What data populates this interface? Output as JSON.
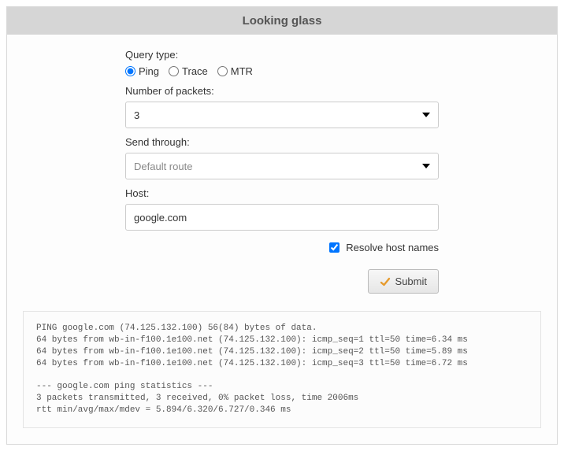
{
  "header": {
    "title": "Looking glass"
  },
  "form": {
    "query_type_label": "Query type:",
    "radios": {
      "ping": "Ping",
      "trace": "Trace",
      "mtr": "MTR",
      "selected": "ping"
    },
    "packets_label": "Number of packets:",
    "packets_value": "3",
    "send_through_label": "Send through:",
    "send_through_value": "Default route",
    "host_label": "Host:",
    "host_value": "google.com",
    "resolve_label": "Resolve host names",
    "resolve_checked": true,
    "submit_label": "Submit"
  },
  "output": "PING google.com (74.125.132.100) 56(84) bytes of data.\n64 bytes from wb-in-f100.1e100.net (74.125.132.100): icmp_seq=1 ttl=50 time=6.34 ms\n64 bytes from wb-in-f100.1e100.net (74.125.132.100): icmp_seq=2 ttl=50 time=5.89 ms\n64 bytes from wb-in-f100.1e100.net (74.125.132.100): icmp_seq=3 ttl=50 time=6.72 ms\n\n--- google.com ping statistics ---\n3 packets transmitted, 3 received, 0% packet loss, time 2006ms\nrtt min/avg/max/mdev = 5.894/6.320/6.727/0.346 ms"
}
